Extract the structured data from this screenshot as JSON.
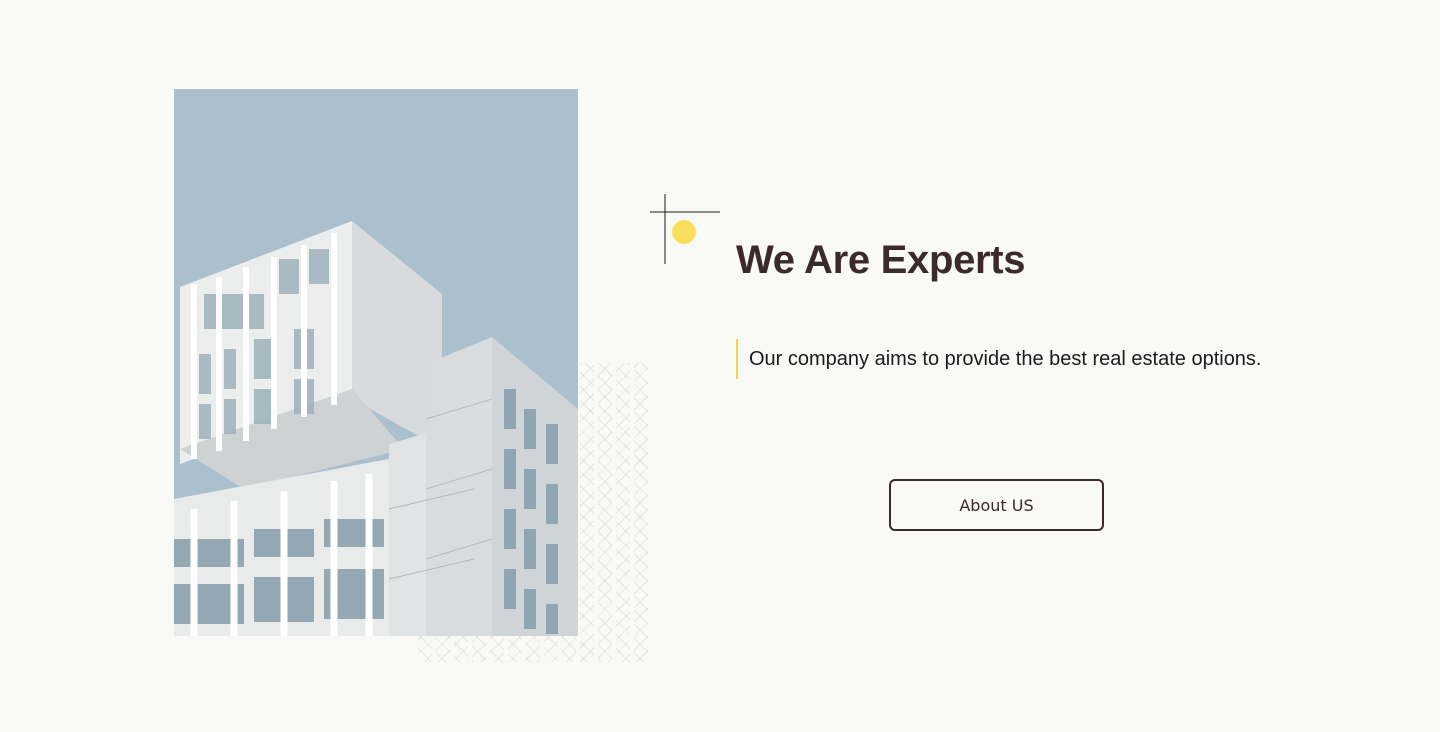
{
  "section": {
    "heading": "We Are Experts",
    "tagline": "Our company aims to provide the best real estate options.",
    "cta_label": "About US"
  },
  "image": {
    "subject": "modern white apartment building against sky",
    "sky_color": "#a9bfcc"
  },
  "ornament": {
    "icon": "crosshair-dot-icon",
    "dot_color": "#f9de5c"
  },
  "colors": {
    "heading": "#3a2a2a",
    "accent_bar": "#f5d547",
    "button_border": "#3a2a2a",
    "background": "#f9f9f7"
  }
}
